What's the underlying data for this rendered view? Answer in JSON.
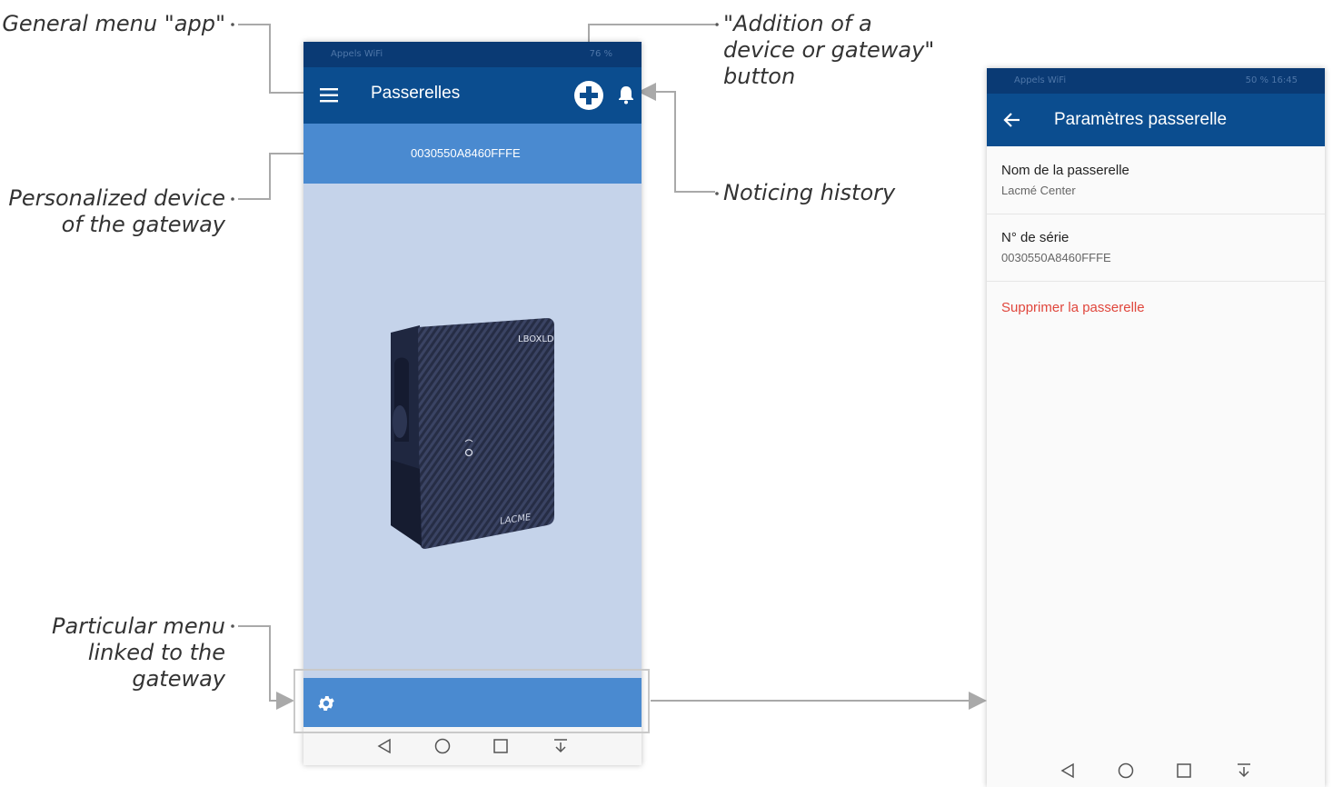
{
  "annotations": {
    "general_menu": "General menu \"app\"",
    "personalized_line1": "Personalized device",
    "personalized_line2": "of the gateway",
    "particular_line1": "Particular menu",
    "particular_line2": "linked to the",
    "particular_line3": "gateway",
    "addition_line1": "\"Addition of a",
    "addition_line2": "device or gateway\"",
    "addition_line3": "button",
    "noticing": "Noticing history"
  },
  "phone1": {
    "status_left": "Appels WiFi",
    "status_right": "76 %",
    "title": "Passerelles",
    "gateway_id": "0030550A8460FFFE",
    "device_brand": "LBOXLD",
    "device_maker": "LACME",
    "icons": [
      "menu-icon",
      "add-circle-icon",
      "bell-icon",
      "gear-icon"
    ]
  },
  "phone2": {
    "status_left": "Appels WiFi",
    "status_right": "50 % 16:45",
    "title": "Paramètres passerelle",
    "rows": [
      {
        "label": "Nom de la passerelle",
        "value": "Lacmé Center"
      },
      {
        "label": "N° de série",
        "value": "0030550A8460FFFE"
      }
    ],
    "delete_label": "Supprimer la passerelle"
  },
  "colors": {
    "status_bar": "#0a3a74",
    "app_bar": "#0b4d8f",
    "accent_band": "#4a8ad0",
    "screen_bg": "#c5d3ea",
    "danger": "#e0463c"
  }
}
